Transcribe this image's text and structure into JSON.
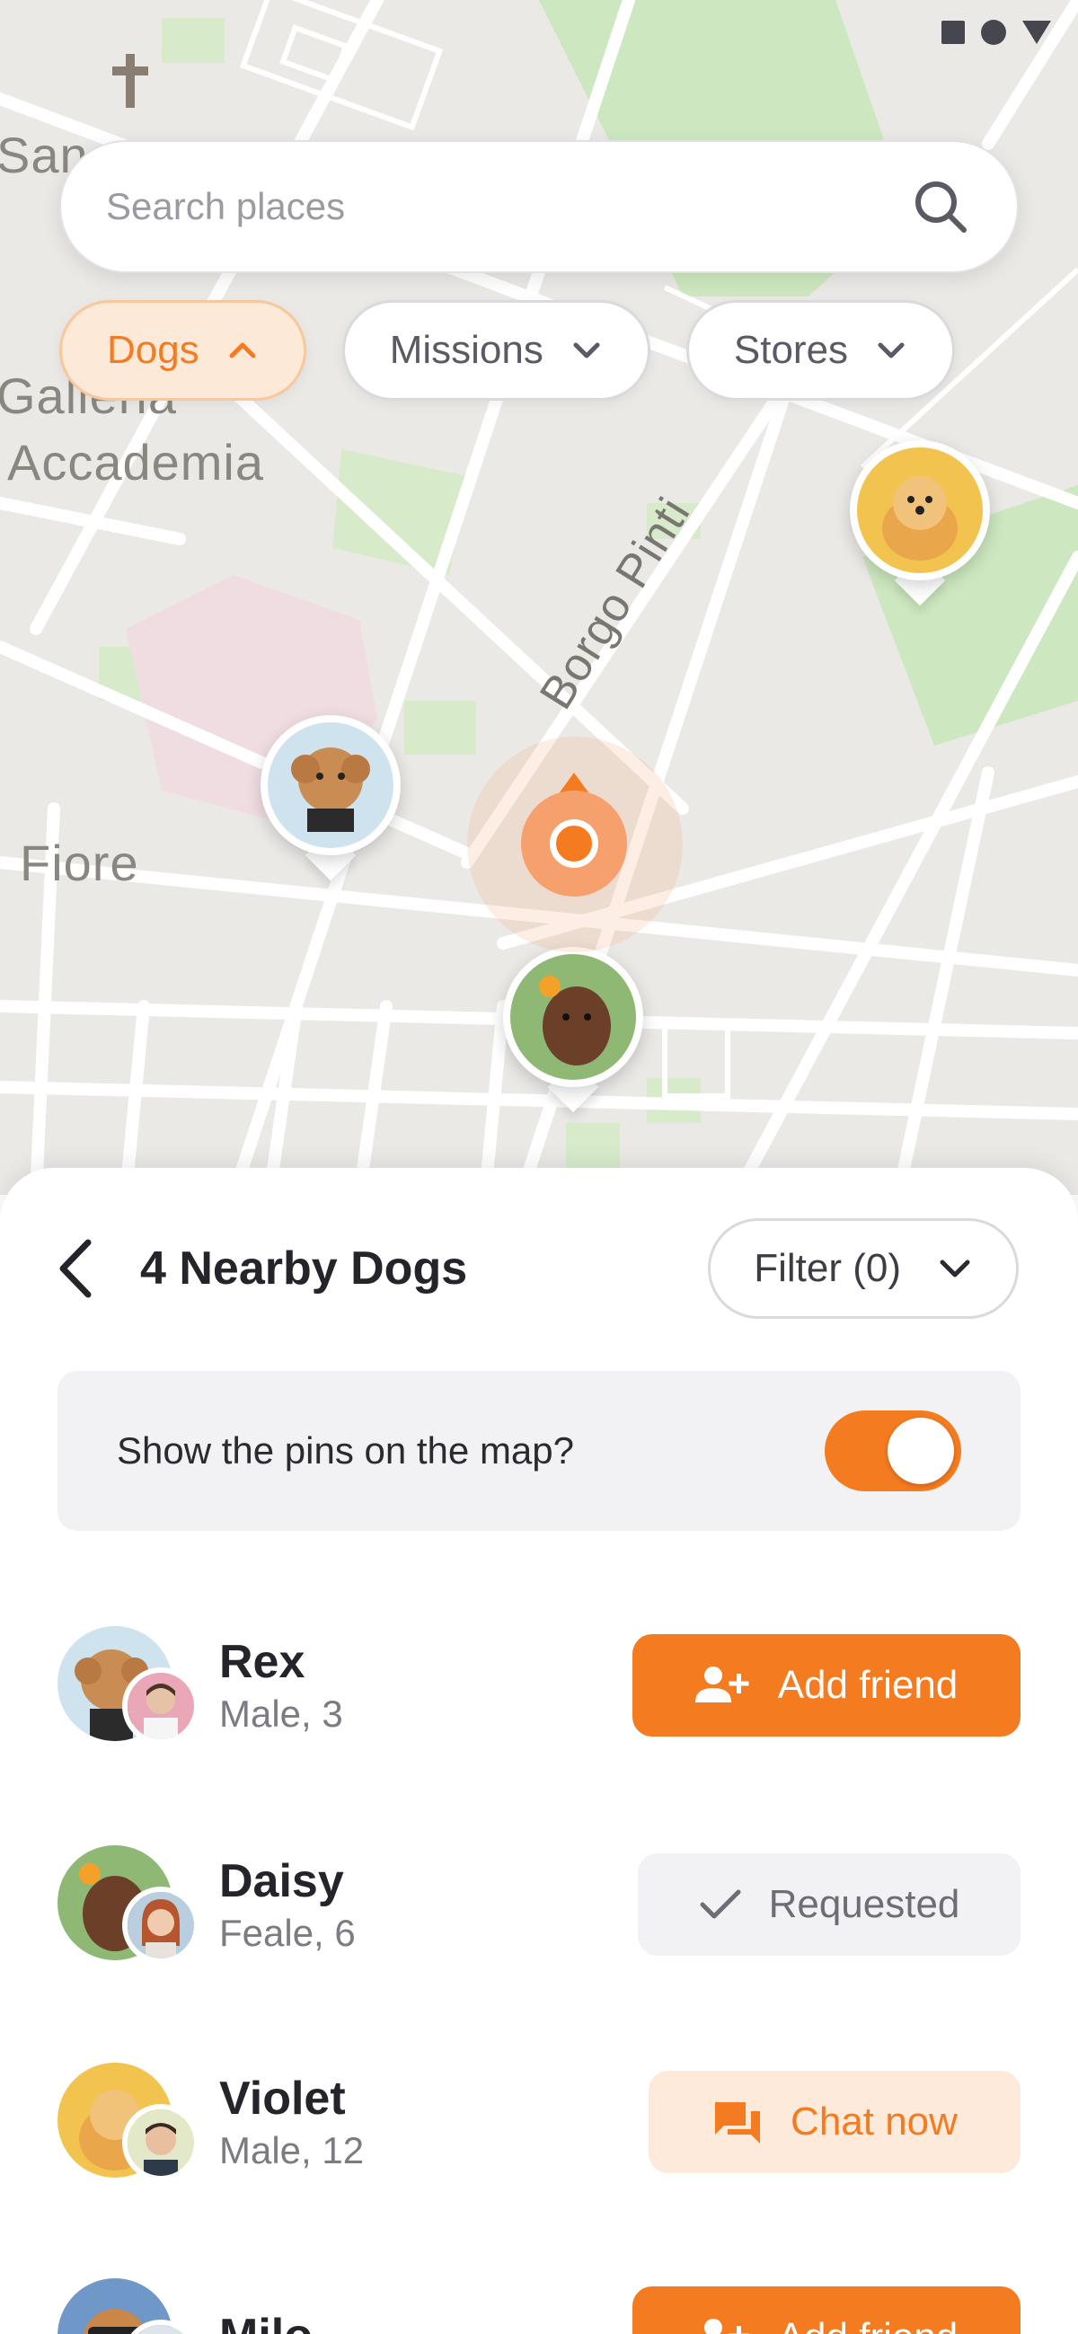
{
  "search": {
    "placeholder": "Search places"
  },
  "chips": [
    {
      "label": "Dogs",
      "active": true
    },
    {
      "label": "Missions",
      "active": false
    },
    {
      "label": "Stores",
      "active": false
    }
  ],
  "map": {
    "labels": [
      "San",
      "Galleria",
      "Accademia",
      "Fiore",
      "Borgo Pinti"
    ]
  },
  "sheet": {
    "title": "4 Nearby Dogs",
    "filter_label": "Filter (0)",
    "toggle_label": "Show the pins on the map?",
    "toggle_on": true
  },
  "dogs": [
    {
      "name": "Rex",
      "meta": "Male, 3",
      "action": "Add friend"
    },
    {
      "name": "Daisy",
      "meta": "Feale, 6",
      "action": "Requested"
    },
    {
      "name": "Violet",
      "meta": "Male, 12",
      "action": "Chat now"
    },
    {
      "name": "Milo",
      "meta": "",
      "action": "Add friend"
    }
  ],
  "colors": {
    "accent": "#f47b20",
    "accent_soft": "#fdeadb",
    "map_bg": "#ebe9e6",
    "park": "#cde8c0"
  }
}
